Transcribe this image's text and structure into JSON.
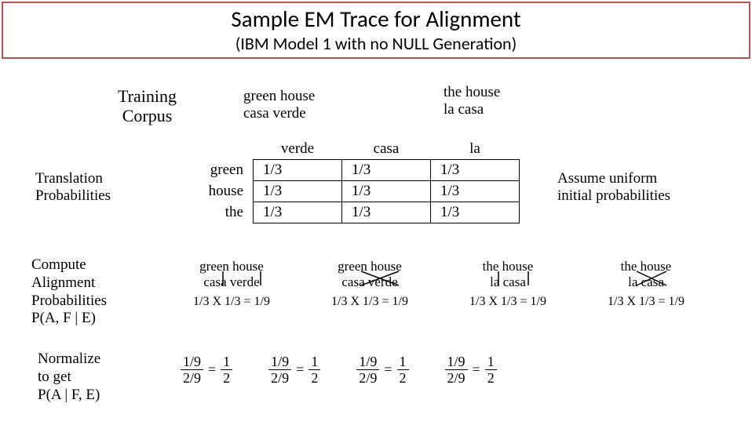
{
  "title": "Sample EM Trace for Alignment",
  "subtitle": "(IBM Model 1 with no NULL Generation)",
  "training_corpus_label_l1": "Training",
  "training_corpus_label_l2": "Corpus",
  "corpus": {
    "pair1_en": "green house",
    "pair1_es": "casa verde",
    "pair2_en": "the house",
    "pair2_es": "la casa"
  },
  "prob_table": {
    "cols": [
      "verde",
      "casa",
      "la"
    ],
    "rows": [
      "green",
      "house",
      "the"
    ],
    "cells": [
      [
        "1/3",
        "1/3",
        "1/3"
      ],
      [
        "1/3",
        "1/3",
        "1/3"
      ],
      [
        "1/3",
        "1/3",
        "1/3"
      ]
    ]
  },
  "tp_label_l1": "Translation",
  "tp_label_l2": "Probabilities",
  "assume_l1": "Assume uniform",
  "assume_l2": "initial probabilities",
  "cap_l1": "Compute",
  "cap_l2": "Alignment",
  "cap_l3": "Probabilities",
  "cap_l4": "P(A, F | E)",
  "norm_l1": "Normalize",
  "norm_l2": "to get",
  "norm_l3": "P(A | F, E)",
  "alignments": [
    {
      "en": "green house",
      "es": "casa verde",
      "mult": "1/3 X 1/3 = 1/9"
    },
    {
      "en": "green house",
      "es": "casa verde",
      "mult": "1/3 X 1/3 = 1/9"
    },
    {
      "en": "the house",
      "es": "la casa",
      "mult": "1/3 X 1/3 = 1/9"
    },
    {
      "en": "the house",
      "es": "la casa",
      "mult": "1/3 X 1/3 = 1/9"
    }
  ],
  "eq_numer": "1/9",
  "eq_denom": "2/9",
  "eq_rhs_n": "1",
  "eq_rhs_d": "2",
  "chart_data": {
    "type": "table",
    "title": "Translation Probabilities (uniform initial)",
    "columns": [
      "verde",
      "casa",
      "la"
    ],
    "rows": [
      "green",
      "house",
      "the"
    ],
    "values": [
      [
        0.3333,
        0.3333,
        0.3333
      ],
      [
        0.3333,
        0.3333,
        0.3333
      ],
      [
        0.3333,
        0.3333,
        0.3333
      ]
    ]
  }
}
